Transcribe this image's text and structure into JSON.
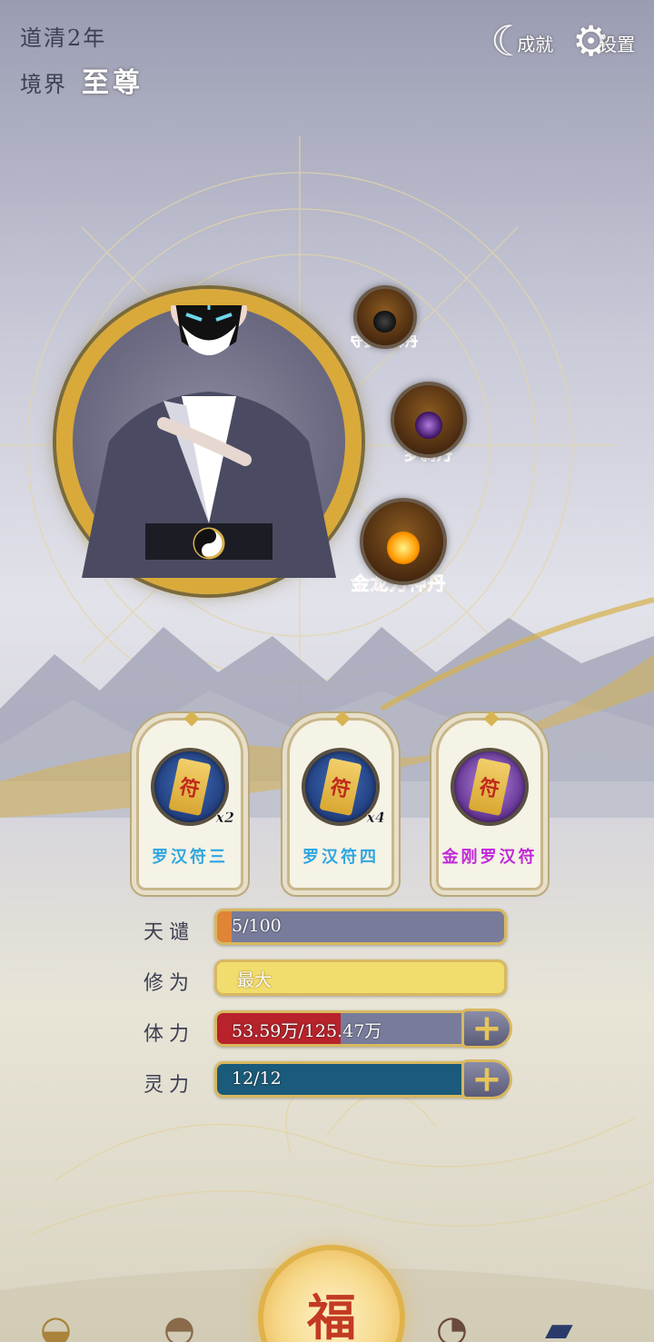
{
  "header": {
    "era": "道清2年",
    "realm_label": "境界",
    "realm_value": "至尊"
  },
  "top_buttons": {
    "achievements_label": "成就",
    "settings_label": "设置"
  },
  "pills": [
    {
      "name": "守护金御丹"
    },
    {
      "name": "罗刹丹"
    },
    {
      "name": "金龙力神丹"
    }
  ],
  "talismans": [
    {
      "name": "罗汉符三",
      "qty": "x2"
    },
    {
      "name": "罗汉符四",
      "qty": "x4"
    },
    {
      "name": "金刚罗汉符",
      "qty": ""
    }
  ],
  "stats": {
    "tianqian": {
      "label": "天谴",
      "value": "5/100",
      "fill": 0.05
    },
    "xiuwei": {
      "label": "修为",
      "value": "最大",
      "fill": 1.0
    },
    "tili": {
      "label": "体力",
      "value": "53.59万/125.47万",
      "fill": 0.43
    },
    "lingli": {
      "label": "灵力",
      "value": "12/12",
      "fill": 1.0
    }
  },
  "main_button": {
    "label": "福"
  },
  "colors": {
    "gold": "#d9a93a",
    "talisman_blue": "#2ea6e0",
    "talisman_purple": "#c028d8",
    "pill_red": "#e0201c"
  }
}
